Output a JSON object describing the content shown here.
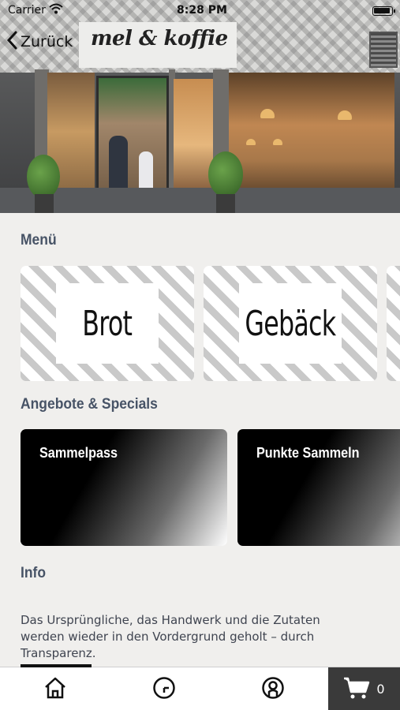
{
  "status_bar": {
    "carrier": "Carrier",
    "time": "8:28 PM",
    "wifi_icon": "wifi-icon",
    "battery_icon": "battery-icon"
  },
  "nav": {
    "back_label": "Zurück",
    "back_icon": "chevron-left-icon"
  },
  "hero": {
    "sign_text": "mel & koffie"
  },
  "menu": {
    "title": "Menü",
    "items": [
      {
        "label": "Brot"
      },
      {
        "label": "Gebäck"
      },
      {
        "label": ""
      }
    ]
  },
  "specials": {
    "title": "Angebote & Specials",
    "items": [
      {
        "label": "Sammelpass"
      },
      {
        "label": "Punkte Sammeln"
      }
    ]
  },
  "info": {
    "title": "Info",
    "text": "Das Ursprüngliche, das Handwerk und die Zutaten werden wieder in den Vordergrund geholt – durch Transparenz."
  },
  "tab_bar": {
    "icons": [
      "home-icon",
      "clock-icon",
      "user-icon",
      "cart-icon"
    ],
    "cart_count": "0"
  },
  "colors": {
    "background": "#f0efed",
    "section_title": "#475366",
    "tab_cart_bg": "#3a3a3a"
  }
}
